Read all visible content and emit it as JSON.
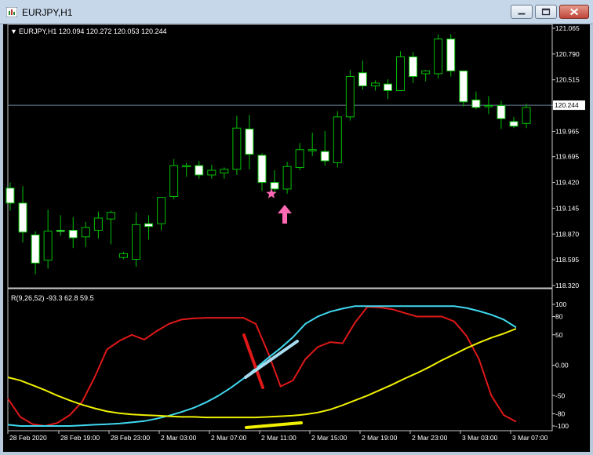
{
  "window": {
    "title": "EURJPY,H1",
    "controls": [
      "minimize-icon",
      "maximize-icon",
      "close-icon"
    ]
  },
  "price_pane": {
    "header": "EURJPY,H1  120.094 120.272 120.053 120.244",
    "collapse_glyph": "▼",
    "current_price_label": "120.244",
    "annotations": [
      "pink-star",
      "pink-up-arrow"
    ]
  },
  "indicator_pane": {
    "header": "R(9,26,52) -93.3 62.8 59.5"
  },
  "colors": {
    "bull": "#ffffff",
    "outline": "#00c000",
    "red": "#e01818",
    "cyan": "#40d8f0",
    "yellow": "#f0f000",
    "pink": "#ff69b4",
    "grid_line": "#6a7f99"
  },
  "chart_data": [
    {
      "type": "candlestick",
      "title": "EURJPY,H1",
      "y_ticks": [
        "121.065",
        "120.790",
        "120.515",
        "120.244",
        "119.965",
        "119.695",
        "119.420",
        "119.145",
        "118.870",
        "118.595",
        "118.320"
      ],
      "x_ticks": [
        "28 Feb 2020",
        "28 Feb 19:00",
        "28 Feb 23:00",
        "2 Mar 03:00",
        "2 Mar 07:00",
        "2 Mar 11:00",
        "2 Mar 15:00",
        "2 Mar 19:00",
        "2 Mar 23:00",
        "3 Mar 03:00",
        "3 Mar 07:00"
      ],
      "ylim": [
        118.32,
        121.065
      ],
      "current_price": 120.244,
      "candles": [
        {
          "o": 119.36,
          "h": 119.42,
          "c": 119.2,
          "l": 119.12
        },
        {
          "o": 119.2,
          "h": 119.38,
          "c": 118.89,
          "l": 118.78
        },
        {
          "o": 118.86,
          "h": 118.9,
          "c": 118.56,
          "l": 118.44
        },
        {
          "o": 118.59,
          "h": 119.13,
          "c": 118.9,
          "l": 118.5
        },
        {
          "o": 118.91,
          "h": 119.07,
          "c": 118.9,
          "l": 118.85
        },
        {
          "o": 118.91,
          "h": 119.05,
          "c": 118.83,
          "l": 118.72
        },
        {
          "o": 118.84,
          "h": 119.0,
          "c": 118.94,
          "l": 118.73
        },
        {
          "o": 118.91,
          "h": 119.11,
          "c": 119.04,
          "l": 118.82
        },
        {
          "o": 119.03,
          "h": 119.12,
          "c": 119.1,
          "l": 118.76
        },
        {
          "o": 118.62,
          "h": 118.68,
          "c": 118.66,
          "l": 118.6
        },
        {
          "o": 118.6,
          "h": 119.1,
          "c": 118.97,
          "l": 118.52
        },
        {
          "o": 118.98,
          "h": 119.07,
          "c": 118.95,
          "l": 118.81
        },
        {
          "o": 118.98,
          "h": 119.2,
          "c": 119.26,
          "l": 118.91
        },
        {
          "o": 119.27,
          "h": 119.67,
          "c": 119.6,
          "l": 119.24
        },
        {
          "o": 119.59,
          "h": 119.63,
          "c": 119.6,
          "l": 119.48
        },
        {
          "o": 119.6,
          "h": 119.65,
          "c": 119.5,
          "l": 119.46
        },
        {
          "o": 119.5,
          "h": 119.61,
          "c": 119.55,
          "l": 119.46
        },
        {
          "o": 119.52,
          "h": 119.58,
          "c": 119.56,
          "l": 119.46
        },
        {
          "o": 119.56,
          "h": 120.13,
          "c": 120.0,
          "l": 119.5
        },
        {
          "o": 119.99,
          "h": 120.14,
          "c": 119.72,
          "l": 119.56
        },
        {
          "o": 119.71,
          "h": 119.73,
          "c": 119.42,
          "l": 119.33
        },
        {
          "o": 119.42,
          "h": 119.55,
          "c": 119.35,
          "l": 119.3
        },
        {
          "o": 119.35,
          "h": 119.64,
          "c": 119.59,
          "l": 119.3
        },
        {
          "o": 119.58,
          "h": 119.84,
          "c": 119.77,
          "l": 119.55
        },
        {
          "o": 119.76,
          "h": 119.95,
          "c": 119.77,
          "l": 119.7
        },
        {
          "o": 119.75,
          "h": 119.97,
          "c": 119.65,
          "l": 119.6
        },
        {
          "o": 119.63,
          "h": 120.18,
          "c": 120.12,
          "l": 119.58
        },
        {
          "o": 120.12,
          "h": 120.62,
          "c": 120.55,
          "l": 120.08
        },
        {
          "o": 120.59,
          "h": 120.72,
          "c": 120.45,
          "l": 120.41
        },
        {
          "o": 120.45,
          "h": 120.51,
          "c": 120.48,
          "l": 120.4
        },
        {
          "o": 120.47,
          "h": 120.52,
          "c": 120.4,
          "l": 120.31
        },
        {
          "o": 120.4,
          "h": 120.82,
          "c": 120.76,
          "l": 120.4
        },
        {
          "o": 120.76,
          "h": 120.81,
          "c": 120.55,
          "l": 120.48
        },
        {
          "o": 120.58,
          "h": 120.62,
          "c": 120.61,
          "l": 120.5
        },
        {
          "o": 120.58,
          "h": 121.0,
          "c": 120.95,
          "l": 120.53
        },
        {
          "o": 120.95,
          "h": 121.0,
          "c": 120.61,
          "l": 120.55
        },
        {
          "o": 120.61,
          "h": 120.61,
          "c": 120.28,
          "l": 120.23
        },
        {
          "o": 120.3,
          "h": 120.39,
          "c": 120.22,
          "l": 120.2
        },
        {
          "o": 120.24,
          "h": 120.34,
          "c": 120.24,
          "l": 120.15
        },
        {
          "o": 120.24,
          "h": 120.29,
          "c": 120.1,
          "l": 119.99
        },
        {
          "o": 120.07,
          "h": 120.12,
          "c": 120.02,
          "l": 120.0
        },
        {
          "o": 120.05,
          "h": 120.26,
          "c": 120.22,
          "l": 120.0
        }
      ]
    },
    {
      "type": "line",
      "title": "R(9,26,52) -93.3 62.8 59.5",
      "y_ticks": [
        "100",
        "80",
        "50",
        "0.00",
        "-50",
        "-80",
        "-100"
      ],
      "ylim": [
        -100,
        100
      ],
      "x_count": 42,
      "series": [
        {
          "color": "#e01818",
          "values": [
            -55,
            -85,
            -97,
            -100,
            -95,
            -82,
            -60,
            -20,
            26,
            40,
            50,
            42,
            56,
            68,
            75,
            77,
            78,
            78,
            78,
            78,
            68,
            20,
            -35,
            -25,
            10,
            30,
            38,
            36,
            70,
            96,
            95,
            92,
            86,
            80,
            80,
            80,
            72,
            48,
            10,
            -50,
            -82,
            -93
          ]
        },
        {
          "color": "#40d8f0",
          "values": [
            -98,
            -100,
            -100,
            -100,
            -100,
            -100,
            -99,
            -98,
            -97,
            -96,
            -94,
            -92,
            -88,
            -83,
            -77,
            -70,
            -61,
            -50,
            -37,
            -22,
            -5,
            12,
            28,
            46,
            68,
            80,
            88,
            93,
            97,
            97,
            97,
            97,
            97,
            97,
            97,
            97,
            97,
            94,
            89,
            83,
            75,
            62
          ]
        },
        {
          "color": "#f0f000",
          "values": [
            -20,
            -25,
            -33,
            -41,
            -50,
            -58,
            -65,
            -71,
            -76,
            -79,
            -81,
            -82,
            -83,
            -84,
            -85,
            -85,
            -86,
            -86,
            -86,
            -86,
            -86,
            -85,
            -84,
            -83,
            -81,
            -78,
            -73,
            -66,
            -58,
            -50,
            -41,
            -32,
            -22,
            -13,
            -3,
            8,
            18,
            28,
            37,
            45,
            52,
            60
          ]
        }
      ]
    }
  ]
}
